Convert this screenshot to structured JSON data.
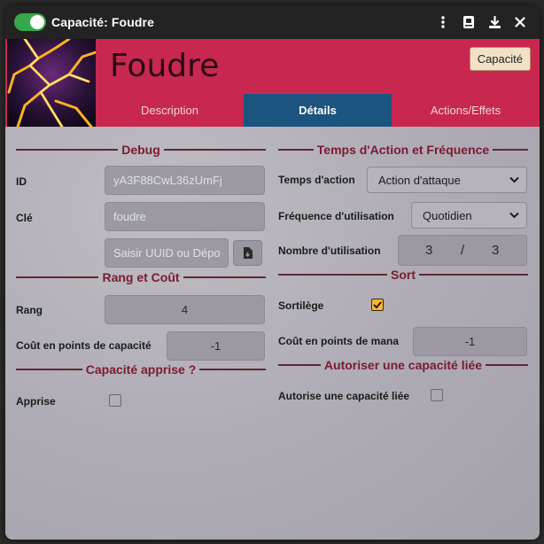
{
  "window": {
    "title": "Capacité: Foudre",
    "enabled": true,
    "icons": [
      "more-vertical-icon",
      "book-icon",
      "download-icon",
      "close-icon"
    ]
  },
  "header": {
    "name": "Foudre",
    "type_badge": "Capacité",
    "colors": {
      "banner": "#c8284f",
      "active_tab": "#1c5480"
    },
    "tabs": [
      {
        "label": "Description",
        "active": false
      },
      {
        "label": "Détails",
        "active": true
      },
      {
        "label": "Actions/Effets",
        "active": false
      }
    ]
  },
  "left": {
    "debug": {
      "heading": "Debug",
      "id_label": "ID",
      "id_value": "yA3F88CwL36zUmFj",
      "key_label": "Clé",
      "key_value": "foudre",
      "uuid_placeholder": "Saisir UUID ou Dépo"
    },
    "rank": {
      "heading": "Rang et Coût",
      "rank_label": "Rang",
      "rank_value": "4",
      "cost_label": "Coût en points de capacité",
      "cost_value": "-1"
    },
    "learned": {
      "heading": "Capacité apprise ?",
      "label": "Apprise",
      "checked": false
    }
  },
  "right": {
    "timing": {
      "heading": "Temps d'Action et Fréquence",
      "action_label": "Temps d'action",
      "action_value": "Action d'attaque",
      "freq_label": "Fréquence d'utilisation",
      "freq_value": "Quotidien",
      "uses_label": "Nombre d'utilisation",
      "uses_current": "3",
      "uses_sep": "/",
      "uses_max": "3"
    },
    "spell": {
      "heading": "Sort",
      "spell_label": "Sortilège",
      "spell_checked": true,
      "mana_label": "Coût en points de mana",
      "mana_value": "-1"
    },
    "linked": {
      "heading": "Autoriser une capacité liée",
      "label": "Autorise une capacité liée",
      "checked": false
    }
  }
}
